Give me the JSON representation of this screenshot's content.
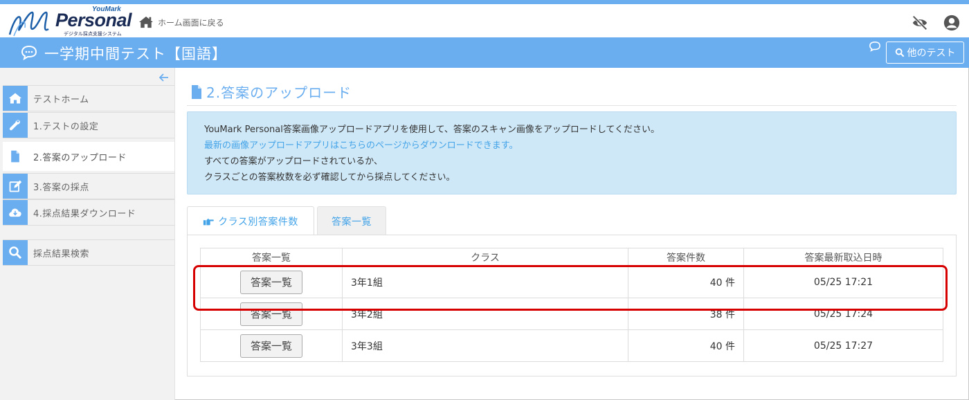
{
  "header": {
    "logo_brand_small": "YouMark",
    "logo_brand": "Personal",
    "logo_subtitle": "デジタル採点支援システム",
    "home_link_label": "ホーム画面に戻る",
    "icons": [
      "home-icon",
      "eye-slash-icon",
      "user-circle-icon"
    ]
  },
  "titlebar": {
    "title": "一学期中間テスト【国語】",
    "other_test_label": "他のテスト",
    "icons": [
      "comment-icon",
      "search-icon"
    ]
  },
  "sidebar": {
    "items": [
      {
        "label": "テストホーム",
        "icon": "home-icon"
      },
      {
        "label": "1.テストの設定",
        "icon": "wrench-icon"
      },
      {
        "label": "2.答案のアップロード",
        "icon": "file-icon",
        "active": true
      },
      {
        "label": "3.答案の採点",
        "icon": "edit-icon"
      },
      {
        "label": "4.採点結果ダウンロード",
        "icon": "cloud-download-icon"
      },
      {
        "label": "採点結果検索",
        "icon": "search-icon"
      }
    ]
  },
  "main": {
    "heading": "2.答案のアップロード",
    "info": {
      "line1": "YouMark Personal答案画像アップロードアプリを使用して、答案のスキャン画像をアップロードしてください。",
      "link": "最新の画像アップロードアプリはこちらのページからダウンロードできます。",
      "line3": "すべての答案がアップロードされているか、",
      "line4": "クラスごとの答案枚数を必ず確認してから採点してください。"
    },
    "tabs": [
      {
        "label": "クラス別答案件数",
        "icon": "hand-point-right-icon",
        "active": true
      },
      {
        "label": "答案一覧",
        "active": false
      }
    ],
    "table": {
      "headers": [
        "答案一覧",
        "クラス",
        "答案件数",
        "答案最新取込日時"
      ],
      "rows": [
        {
          "button": "答案一覧",
          "class": "3年1組",
          "count": "40 件",
          "date": "05/25 17:21"
        },
        {
          "button": "答案一覧",
          "class": "3年2組",
          "count": "38 件",
          "date": "05/25 17:24"
        },
        {
          "button": "答案一覧",
          "class": "3年3組",
          "count": "40 件",
          "date": "05/25 17:27"
        }
      ]
    }
  },
  "colors": {
    "accent": "#6aaef0",
    "link": "#42a3e8",
    "info_bg": "#cfe8f7",
    "highlight": "#d60000",
    "logo_navy": "#1a2b55"
  }
}
